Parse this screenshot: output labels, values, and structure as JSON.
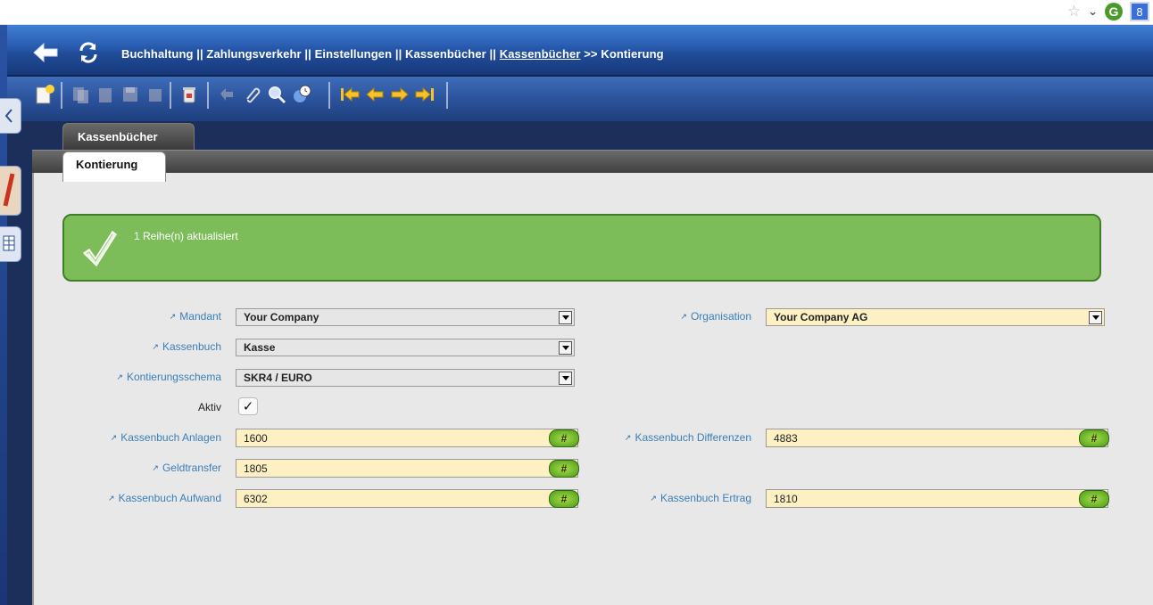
{
  "browser": {
    "icons": [
      "star-icon",
      "chevron-down-icon",
      "extension-g-icon",
      "extension-8-icon"
    ],
    "ext_g_label": "G",
    "ext_b_label": "8"
  },
  "header": {
    "breadcrumb_prefix": "Buchhaltung || Zahlungsverkehr || Einstellungen || Kassenbücher  ||",
    "breadcrumb_link": "Kassenbücher",
    "breadcrumb_suffix": ">> Kontierung"
  },
  "tabs": {
    "parent_tab": "Kassenbücher",
    "active_tab": "Kontierung"
  },
  "message": {
    "text": "1 Reihe(n) aktualisiert",
    "color": "#7cbd5a"
  },
  "form": {
    "mandant": {
      "label": "Mandant",
      "value": "Your Company"
    },
    "organisation": {
      "label": "Organisation",
      "value": "Your Company AG"
    },
    "kassenbuch": {
      "label": "Kassenbuch",
      "value": "Kasse"
    },
    "kontierungsschema": {
      "label": "Kontierungsschema",
      "value": "SKR4 / EURO"
    },
    "aktiv": {
      "label": "Aktiv",
      "checked": true,
      "mark": "✓"
    },
    "kassenbuch_anlagen": {
      "label": "Kassenbuch Anlagen",
      "value": "1600"
    },
    "kassenbuch_differenzen": {
      "label": "Kassenbuch Differenzen",
      "value": "4883"
    },
    "geldtransfer": {
      "label": "Geldtransfer",
      "value": "1805"
    },
    "kassenbuch_aufwand": {
      "label": "Kassenbuch Aufwand",
      "value": "6302"
    },
    "kassenbuch_ertrag": {
      "label": "Kassenbuch Ertrag",
      "value": "1810"
    },
    "lookup_label": "#"
  }
}
